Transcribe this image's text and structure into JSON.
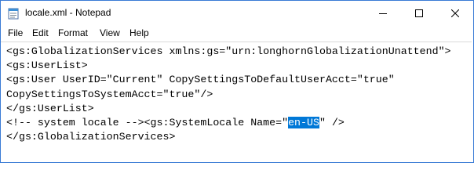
{
  "window": {
    "title": "locale.xml - Notepad",
    "accent_color": "#0078d7"
  },
  "titlebar": {
    "app_icon": "notepad-icon",
    "minimize_icon": "minimize-icon",
    "maximize_icon": "maximize-icon",
    "close_icon": "close-icon"
  },
  "menu": {
    "items": [
      "File",
      "Edit",
      "Format",
      "View",
      "Help"
    ]
  },
  "editor": {
    "lines": [
      "<gs:GlobalizationServices xmlns:gs=\"urn:longhornGlobalizationUnattend\">",
      "<gs:UserList>",
      "<gs:User UserID=\"Current\" CopySettingsToDefaultUserAcct=\"true\"",
      "CopySettingsToSystemAcct=\"true\"/>",
      "</gs:UserList>"
    ],
    "line6_before": "<!-- system locale --><gs:SystemLocale Name=\"",
    "line6_selected": "en-US",
    "line6_after": "\" />",
    "line7": "</gs:GlobalizationServices>",
    "selection_color": "#0078d7"
  }
}
